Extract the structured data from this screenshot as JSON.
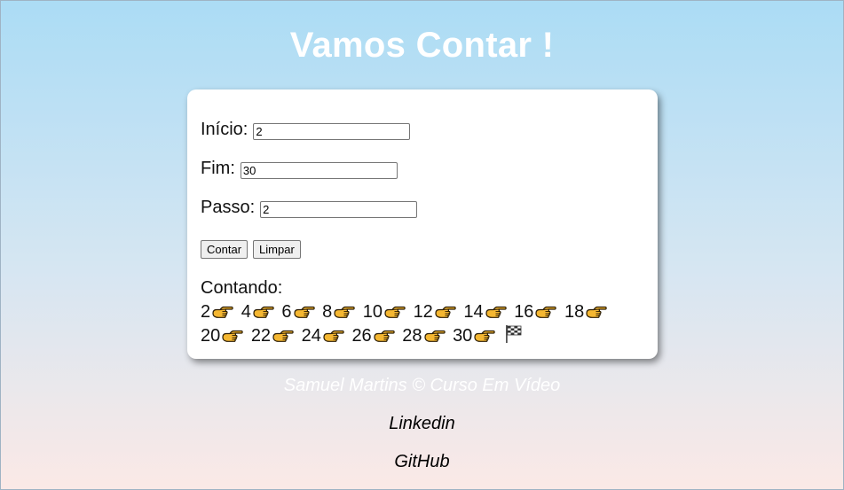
{
  "header": {
    "title": "Vamos Contar !"
  },
  "form": {
    "inicio": {
      "label": "Início:",
      "value": "2"
    },
    "fim": {
      "label": "Fim:",
      "value": "30"
    },
    "passo": {
      "label": "Passo:",
      "value": "2"
    },
    "count_button": "Contar",
    "clear_button": "Limpar"
  },
  "result": {
    "heading": "Contando:",
    "sequence": [
      "2",
      "4",
      "6",
      "8",
      "10",
      "12",
      "14",
      "16",
      "18",
      "20",
      "22",
      "24",
      "26",
      "28",
      "30"
    ],
    "separator_icon": "pointing-right-hand-icon",
    "end_icon": "checkered-flag-icon"
  },
  "footer": {
    "credit": "Samuel Martins © Curso Em Vídeo",
    "links": [
      "Linkedin",
      "GitHub"
    ]
  },
  "colors": {
    "title": "#ffffff",
    "card_background": "#ffffff",
    "gradient_top": "#abdcf5",
    "gradient_bottom": "#fbe9e6"
  }
}
